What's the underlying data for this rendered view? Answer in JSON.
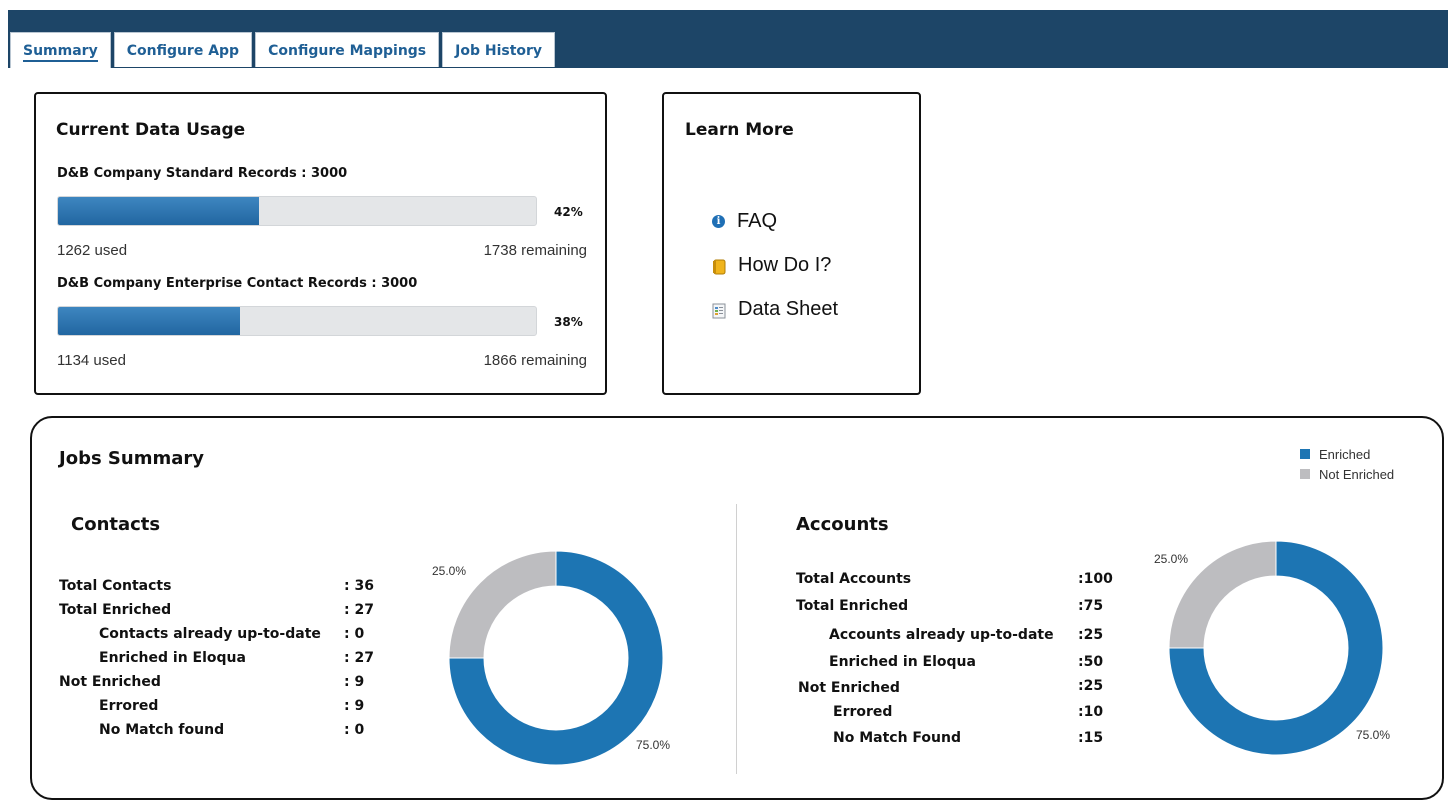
{
  "tabs": [
    {
      "label": "Summary",
      "active": true
    },
    {
      "label": "Configure App",
      "active": false
    },
    {
      "label": "Configure Mappings",
      "active": false
    },
    {
      "label": "Job History",
      "active": false
    }
  ],
  "usage": {
    "title": "Current Data Usage",
    "records": [
      {
        "title": "D&B Company Standard Records : 3000",
        "percent": 42,
        "percent_label": "42%",
        "used": "1262  used",
        "remaining": "1738  remaining"
      },
      {
        "title": "D&B Company Enterprise Contact Records : 3000",
        "percent": 38,
        "percent_label": "38%",
        "used": "1134  used",
        "remaining": "1866  remaining"
      }
    ]
  },
  "learn_more": {
    "title": "Learn More",
    "links": [
      {
        "label": "FAQ",
        "icon": "info-icon"
      },
      {
        "label": "How Do I?",
        "icon": "book-icon"
      },
      {
        "label": "Data Sheet",
        "icon": "document-icon"
      }
    ]
  },
  "jobs": {
    "title": "Jobs Summary",
    "legend": [
      {
        "label": "Enriched",
        "color": "#1d75b3"
      },
      {
        "label": "Not Enriched",
        "color": "#bdbdc0"
      }
    ],
    "contacts": {
      "title": "Contacts",
      "stats": [
        {
          "label": "Total Contacts",
          "value": ":  36"
        },
        {
          "label": "Total Enriched",
          "value": ":  27"
        },
        {
          "label": "Contacts already up-to-date",
          "value": ":  0"
        },
        {
          "label": "Enriched in Eloqua",
          "value": ":  27"
        },
        {
          "label": "Not Enriched",
          "value": ":  9"
        },
        {
          "label": "Errored",
          "value": ":  9"
        },
        {
          "label": "No Match found",
          "value": ":  0"
        }
      ]
    },
    "accounts": {
      "title": "Accounts",
      "stats": [
        {
          "label": "Total Accounts",
          "value": ":100"
        },
        {
          "label": "Total Enriched",
          "value": ":75"
        },
        {
          "label": "Accounts already up-to-date",
          "value": ":25"
        },
        {
          "label": "Enriched in Eloqua",
          "value": ":50"
        },
        {
          "label": "Not Enriched",
          "value": ":25"
        },
        {
          "label": "Errored",
          "value": ":10"
        },
        {
          "label": "No Match Found",
          "value": ":15"
        }
      ]
    }
  },
  "chart_data": [
    {
      "type": "pie",
      "title": "Contacts",
      "categories": [
        "Enriched",
        "Not Enriched"
      ],
      "values": [
        75.0,
        25.0
      ],
      "labels": [
        "75.0%",
        "25.0%"
      ],
      "donut": true,
      "legend": "top-right"
    },
    {
      "type": "pie",
      "title": "Accounts",
      "categories": [
        "Enriched",
        "Not Enriched"
      ],
      "values": [
        75.0,
        25.0
      ],
      "labels": [
        "75.0%",
        "25.0%"
      ],
      "donut": true,
      "legend": "top-right"
    }
  ]
}
